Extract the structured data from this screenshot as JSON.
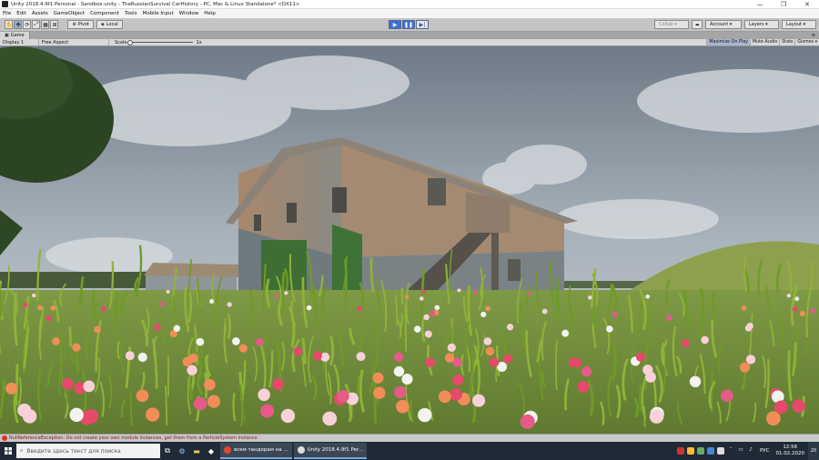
{
  "window": {
    "title": "Unity 2018.4.9f1 Personal - Sandbox.unity - TheRussianSurvival CarHistory - PC, Mac & Linux Standalone* <DX11>",
    "controls": [
      "—",
      "❐",
      "✕"
    ]
  },
  "menu": [
    "File",
    "Edit",
    "Assets",
    "GameObject",
    "Component",
    "Tools",
    "Mobile Input",
    "Window",
    "Help"
  ],
  "toolbar": {
    "tools": [
      "✋",
      "✥",
      "⟳",
      "⤢",
      "▦",
      "⊞"
    ],
    "pivot_label": "Pivot",
    "local_label": "Local",
    "playback": [
      "▶",
      "❚❚",
      "▶|"
    ],
    "collab_label": "Collab ▾",
    "account_label": "Account ▾",
    "layers_label": "Layers ▾",
    "layout_label": "Layout ▾"
  },
  "game_view": {
    "tab_label": "Game",
    "display_label": "Display 1",
    "aspect_label": "Free Aspect",
    "scale_label": "Scale",
    "scale_value": "1x",
    "buttons": [
      "Maximize On Play",
      "Mute Audio",
      "Stats",
      "Gizmos ▾"
    ]
  },
  "console": {
    "error_message": "NullReferenceException: Do not create your own module instances, get them from a ParticleSystem instance"
  },
  "taskbar": {
    "search_placeholder": "Введите здесь текст для поиска",
    "tasks": [
      {
        "label": "всем тандорам на ...",
        "color": "#e0482f"
      },
      {
        "label": "Unity 2018.4.9f1 Per...",
        "color": "#dddddd"
      }
    ],
    "language": "РУС",
    "time": "12:56",
    "date": "01.02.2020",
    "notification_count": "20"
  },
  "colors": {
    "accent": "#3c6fd8",
    "error": "#d32222",
    "taskbar": "#1f2a36"
  }
}
